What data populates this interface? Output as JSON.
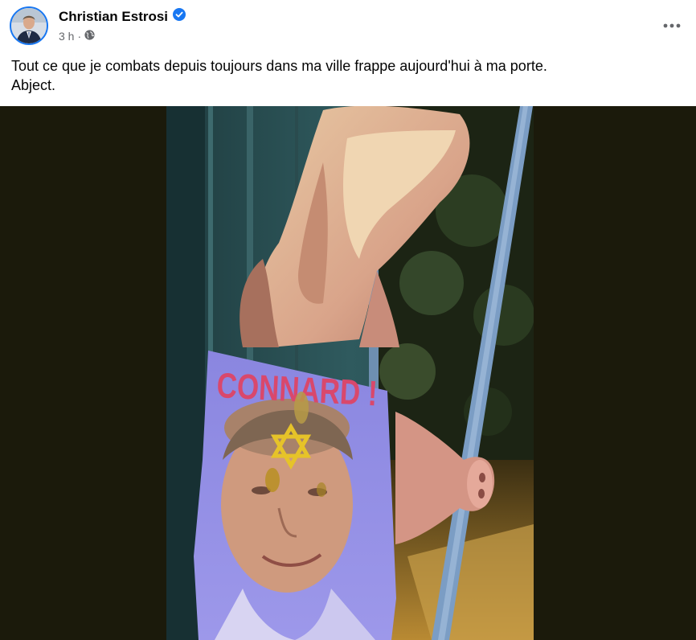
{
  "post": {
    "author_name": "Christian Estrosi",
    "time": "3 h",
    "separator": "·",
    "caption_line1": "Tout ce que je combats depuis toujours dans ma ville frappe aujourd'hui à ma porte.",
    "caption_line2": "Abject.",
    "photo_text": "CONNARD !"
  },
  "icons": {
    "verified": "verified-badge-icon",
    "audience": "globe-icon",
    "more": "more-options-icon"
  },
  "colors": {
    "verified_blue": "#1877f2",
    "text_primary": "#050505",
    "text_secondary": "#65676b",
    "photo_background": "#1b1a0b"
  }
}
